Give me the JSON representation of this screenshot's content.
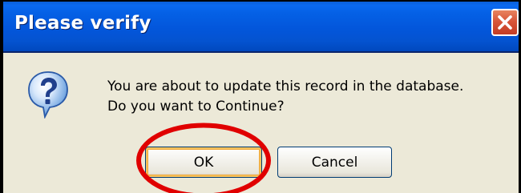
{
  "window": {
    "title": "Please verify",
    "close_icon": "close-icon"
  },
  "content": {
    "icon": "question-icon",
    "message_line1": "You are about to update this record in the database.",
    "message_line2": "Do you want to Continue?"
  },
  "buttons": {
    "ok_label": "OK",
    "cancel_label": "Cancel",
    "focused": "OK"
  },
  "annotation": {
    "type": "highlight-ellipse",
    "target": "OK",
    "color": "#e00000"
  },
  "colors": {
    "titlebar": "#0356db",
    "dialog_background": "#ece9d8",
    "close_button": "#d8563a",
    "focus_ring": "#f0a838"
  }
}
